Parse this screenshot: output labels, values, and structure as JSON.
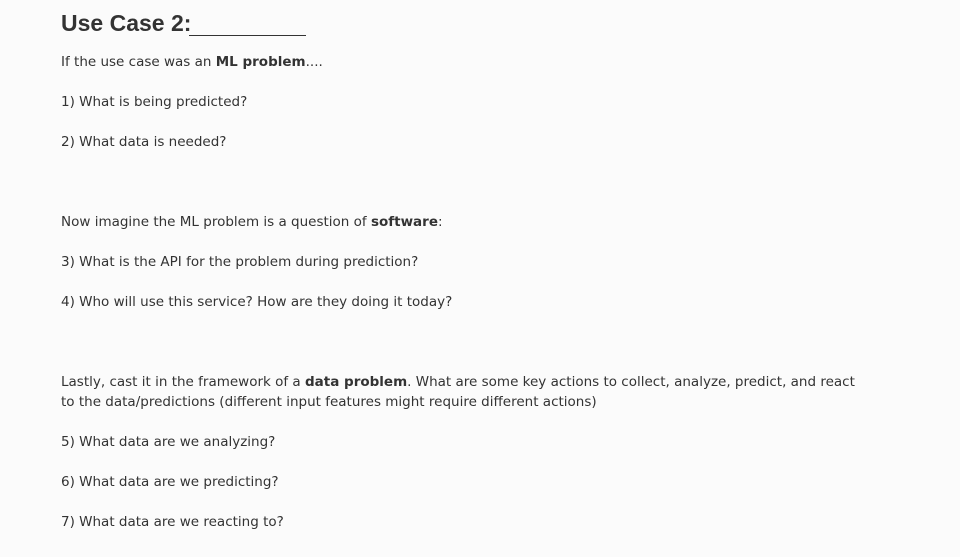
{
  "title": {
    "prefix": "Use Case 2:"
  },
  "section1": {
    "intro_before": "If the use case was an ",
    "intro_bold": "ML problem",
    "intro_after": "....",
    "q1": "1) What is being predicted?",
    "q2": "2) What data is needed?"
  },
  "section2": {
    "intro_before": "Now imagine the ML problem is a question of ",
    "intro_bold": "software",
    "intro_after": ":",
    "q3": "3) What is the API for the problem during prediction?",
    "q4": "4) Who will use this service? How are they doing it today?"
  },
  "section3": {
    "intro_before": "Lastly, cast it in the framework of a ",
    "intro_bold": "data problem",
    "intro_after": ". What are some key actions to collect, analyze, predict, and react to the data/predictions (different input features might require different actions)",
    "q5": "5) What data are we analyzing?",
    "q6": "6) What data are we predicting?",
    "q7": "7) What data are we reacting to?"
  }
}
